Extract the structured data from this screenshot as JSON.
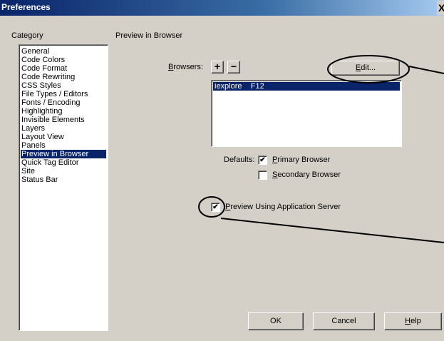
{
  "window": {
    "title": "Preferences",
    "close_glyph": "X"
  },
  "category": {
    "label": "Category",
    "items": [
      "General",
      "Code Colors",
      "Code Format",
      "Code Rewriting",
      "CSS Styles",
      "File Types / Editors",
      "Fonts / Encoding",
      "Highlighting",
      "Invisible Elements",
      "Layers",
      "Layout View",
      "Panels",
      "Preview in Browser",
      "Quick Tag Editor",
      "Site",
      "Status Bar"
    ],
    "selected": "Preview in Browser"
  },
  "panel": {
    "title": "Preview in Browser",
    "browsers_label_ul": "B",
    "browsers_label_rest": "rowsers:",
    "add_glyph": "+",
    "remove_glyph": "−",
    "edit_ul": "E",
    "edit_rest": "dit...",
    "browser_list": [
      "iexplore    F12"
    ],
    "defaults_label": "Defaults:",
    "primary_ul": "P",
    "primary_rest": "rimary Browser",
    "primary_checked": true,
    "secondary_ul": "S",
    "secondary_rest": "econdary Browser",
    "secondary_checked": false,
    "preview_server_ul": "P",
    "preview_server_rest": "review Using Application Server",
    "preview_server_checked": true,
    "check_glyph": "✔"
  },
  "buttons": {
    "ok": "OK",
    "cancel": "Cancel",
    "help_ul": "H",
    "help_rest": "elp"
  }
}
